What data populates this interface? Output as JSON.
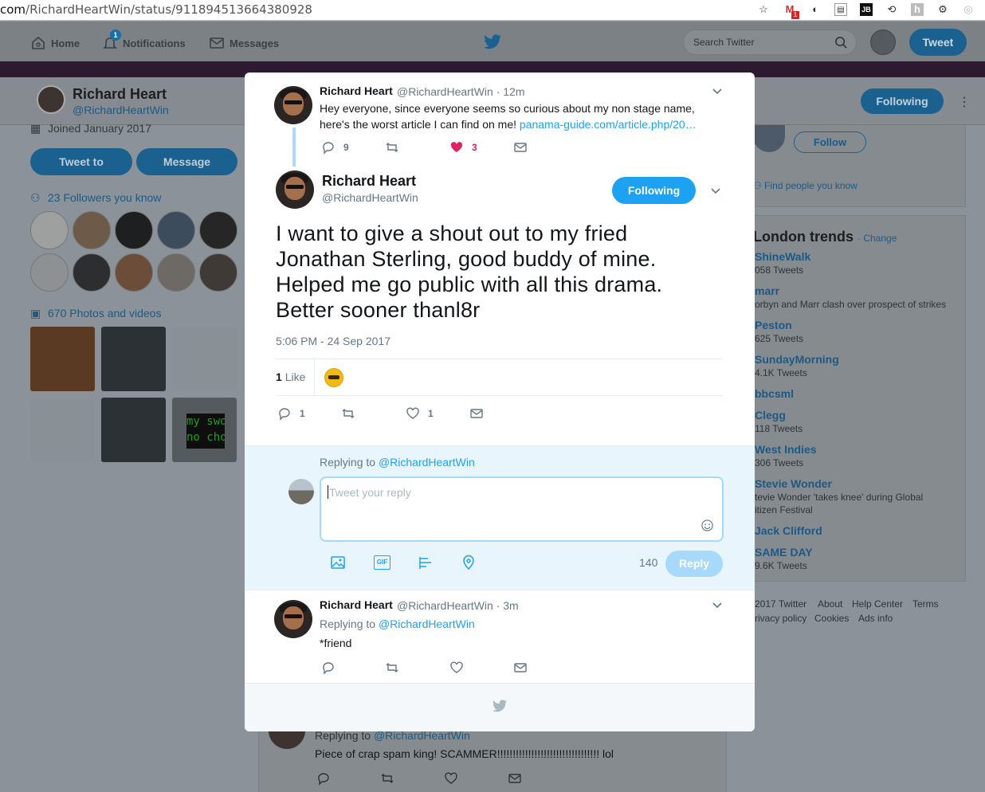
{
  "browser": {
    "url_prefix": "com",
    "url_path": "/RichardHeartWin/status/911894513664380928",
    "gmail_count": "1"
  },
  "nav": {
    "home": "Home",
    "notifications": "Notifications",
    "notif_badge": "1",
    "messages": "Messages",
    "search_placeholder": "Search Twitter",
    "tweet": "Tweet"
  },
  "profile": {
    "name": "Richard Heart",
    "handle": "@RichardHeartWin",
    "following": "Following",
    "joined": "Joined January 2017",
    "tweet_to": "Tweet to",
    "message": "Message",
    "followers_know": "23 Followers you know",
    "photos": "670 Photos and videos",
    "photo_overlay": "my swo\nno choi"
  },
  "sidebar": {
    "follow": "Follow",
    "find_people": "Find people you know",
    "trends_title": "London trends",
    "change": "· Change",
    "trends": [
      {
        "name": "ShineWalk",
        "sub": "058 Tweets"
      },
      {
        "name": "marr",
        "sub": "orbyn and Marr clash over prospect of strikes"
      },
      {
        "name": "Peston",
        "sub": "625 Tweets"
      },
      {
        "name": "SundayMorning",
        "sub": "4.1K Tweets"
      },
      {
        "name": "bbcsml",
        "sub": ""
      },
      {
        "name": "Clegg",
        "sub": "118 Tweets"
      },
      {
        "name": "West Indies",
        "sub": "306 Tweets"
      },
      {
        "name": "Stevie Wonder",
        "sub": "tevie Wonder 'takes knee' during Global"
      },
      {
        "name": "",
        "sub": "itizen Festival"
      },
      {
        "name": "Jack Clifford",
        "sub": ""
      },
      {
        "name": "SAME DAY",
        "sub": "9.6K Tweets"
      }
    ],
    "footer": [
      "2017 Twitter",
      "About",
      "Help Center",
      "Terms",
      "rivacy policy",
      "Cookies",
      "Ads info"
    ]
  },
  "bg_tweet": {
    "replying": "Replying to",
    "handle": "@RichardHeartWin",
    "text": "Piece of crap spam king! SCAMMER!!!!!!!!!!!!!!!!!!!!!!!!!!!!!!!!! lol"
  },
  "modal": {
    "parent": {
      "name": "Richard Heart",
      "handle": "@RichardHeartWin",
      "time": "· 12m",
      "text": "Hey everyone, since everyone seems so curious about my non stage name, here's the worst article I can find on me!",
      "link": "panama-guide.com/article.php/20…",
      "replies": "9",
      "likes": "3"
    },
    "main": {
      "name": "Richard Heart",
      "handle": "@RichardHeartWin",
      "following": "Following",
      "text": "I want to give a shout out to my fried Jonathan Sterling, good buddy of mine. Helped me go public with all this drama. Better sooner thanl8r",
      "timestamp": "5:06 PM - 24 Sep 2017",
      "like_count": "1",
      "like_label": "Like",
      "replies": "1",
      "likes": "1"
    },
    "reply": {
      "replying": "Replying to",
      "handle": "@RichardHeartWin",
      "placeholder": "Tweet your reply",
      "counter": "140",
      "button": "Reply"
    },
    "child": {
      "name": "Richard Heart",
      "handle": "@RichardHeartWin",
      "time": "· 3m",
      "replying": "Replying to",
      "reply_handle": "@RichardHeartWin",
      "text": "*friend"
    }
  },
  "colors": {
    "accent": "#1da1f2",
    "like_red": "#e0245e",
    "dim_overlay": "#8b9299"
  }
}
